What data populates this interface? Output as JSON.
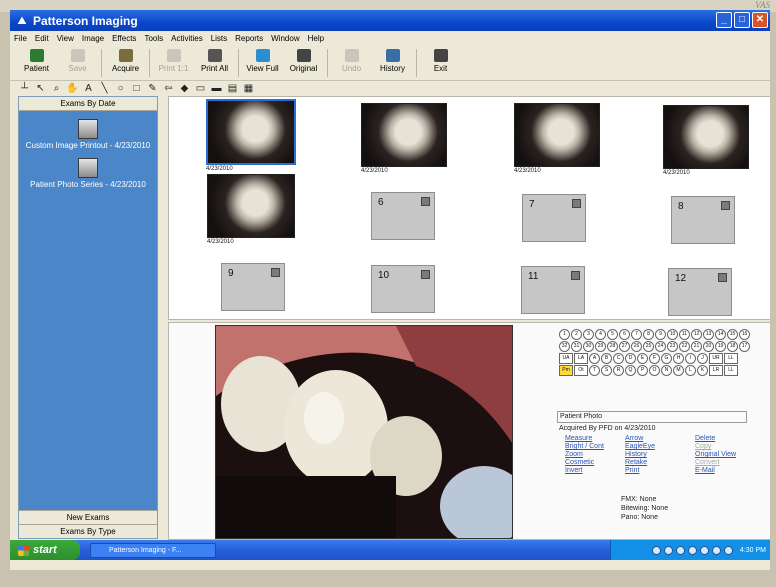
{
  "bezel": {
    "label": "VAS"
  },
  "window": {
    "title": "Patterson Imaging"
  },
  "menu": [
    "File",
    "Edit",
    "View",
    "Image",
    "Effects",
    "Tools",
    "Activities",
    "Lists",
    "Reports",
    "Window",
    "Help"
  ],
  "toolbar": [
    {
      "label": "Patient",
      "enabled": true,
      "color": "#2d7a33"
    },
    {
      "label": "Save",
      "enabled": false
    },
    {
      "label": "Acquire",
      "enabled": true,
      "color": "#7a6c3c"
    },
    {
      "label": "Print 1:1",
      "enabled": false
    },
    {
      "label": "Print All",
      "enabled": true,
      "color": "#555555"
    },
    {
      "label": "View Full",
      "enabled": true,
      "color": "#2b8fcf"
    },
    {
      "label": "Original",
      "enabled": true,
      "color": "#444444"
    },
    {
      "label": "Undo",
      "enabled": false
    },
    {
      "label": "History",
      "enabled": true,
      "color": "#3a6ea8"
    },
    {
      "label": "Exit",
      "enabled": true,
      "color": "#444444"
    }
  ],
  "tools_icons": [
    "dropper-icon",
    "pointer-icon",
    "zoom-icon",
    "hand-icon",
    "text-icon",
    "line-icon",
    "ellipse-icon",
    "rect-icon",
    "pen-icon",
    "arrow-icon",
    "color-picker-icon",
    "callout-icon",
    "ruler-icon",
    "note-icon",
    "grid-icon"
  ],
  "sidebar": {
    "header": "Exams By Date",
    "items": [
      {
        "label": "Custom Image Printout - 4/23/2010"
      },
      {
        "label": "Patient Photo Series - 4/23/2010"
      }
    ],
    "footer1": "New Exams",
    "footer2": "Exams By Type"
  },
  "thumbnails": [
    {
      "date": "4/23/2010"
    },
    {
      "date": "4/23/2010"
    },
    {
      "date": "4/23/2010"
    },
    {
      "date": "4/23/2010"
    },
    {
      "date": "4/23/2010"
    }
  ],
  "slots": [
    "6",
    "7",
    "8",
    "9",
    "10",
    "11",
    "12"
  ],
  "tooth_chart": {
    "row1": [
      "1",
      "2",
      "3",
      "4",
      "5",
      "6",
      "7",
      "8",
      "9",
      "10",
      "11",
      "12",
      "13",
      "14",
      "15",
      "16"
    ],
    "row2": [
      "32",
      "31",
      "30",
      "29",
      "28",
      "27",
      "26",
      "25",
      "24",
      "23",
      "22",
      "21",
      "20",
      "19",
      "18",
      "17"
    ],
    "row3": [
      "UA",
      "LA",
      "A",
      "B",
      "C",
      "D",
      "E",
      "F",
      "G",
      "H",
      "I",
      "J",
      "UR",
      "LL"
    ],
    "row4": [
      "Pm",
      "Ot",
      "T",
      "S",
      "R",
      "Q",
      "P",
      "O",
      "N",
      "M",
      "L",
      "K",
      "LR",
      "LL"
    ]
  },
  "detail": {
    "patient_box": "Patient Photo",
    "acquired": "Acquired By PFD on 4/23/2010",
    "links_col1": [
      "Measure",
      "Bright / Cont",
      "Zoom",
      "Cosmetic",
      "Invert"
    ],
    "links_col2": [
      "Arrow",
      "EagleEye",
      "History",
      "Retake",
      "Print"
    ],
    "links_col3": [
      "Delete",
      "Copy",
      "Original View",
      "Convert",
      "E-Mail"
    ],
    "fmx": "FMX: None",
    "bitewing": "Bitewing: None",
    "pano": "Pano: None"
  },
  "taskbar": {
    "start": "start",
    "task": "Patterson Imaging - F...",
    "clock": "4:30 PM"
  }
}
